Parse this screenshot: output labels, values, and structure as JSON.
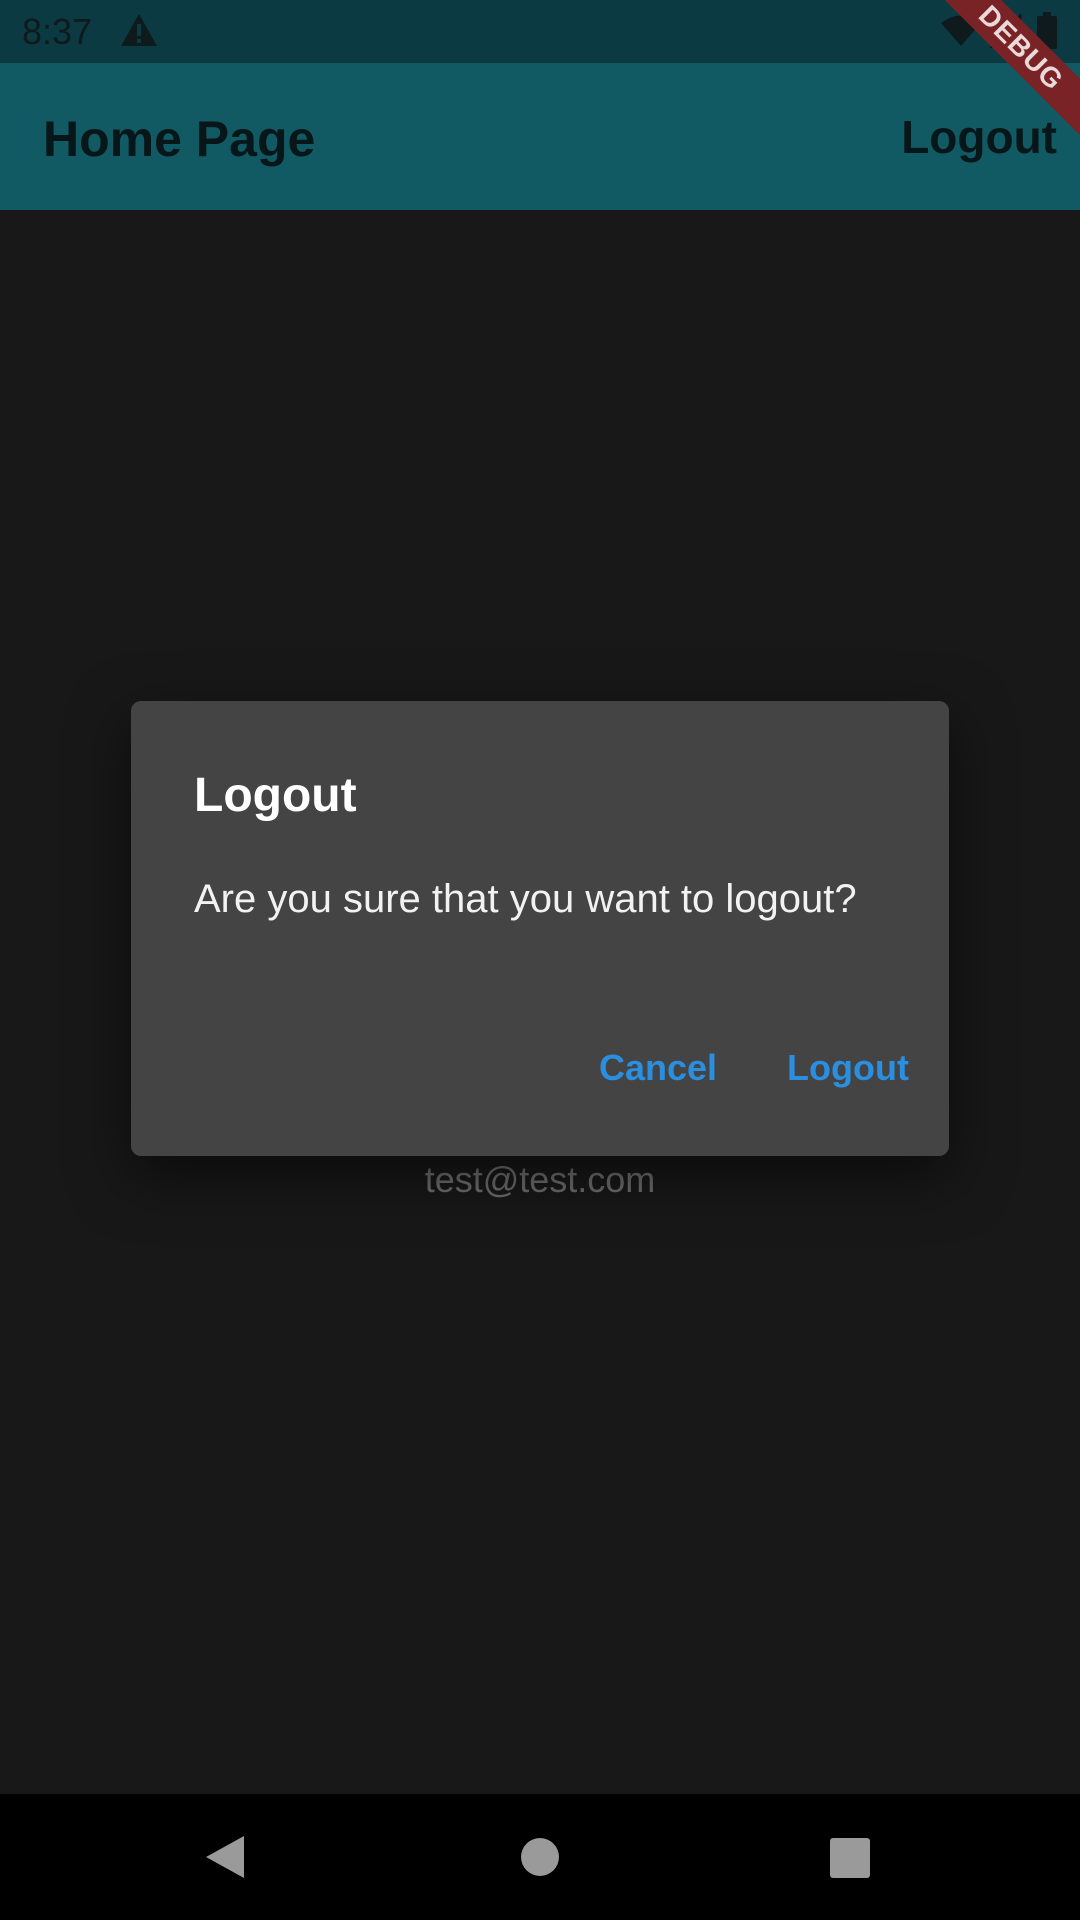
{
  "status_bar": {
    "time": "8:37",
    "icons": [
      "warning-icon",
      "wifi-icon",
      "signal-icon",
      "battery-icon"
    ]
  },
  "app_bar": {
    "title": "Home Page",
    "logout_label": "Logout",
    "background_color": "#115a63"
  },
  "debug_banner": {
    "label": "DEBUG",
    "color": "#7a2326"
  },
  "background_content": {
    "email": "test@test.com"
  },
  "dialog": {
    "title": "Logout",
    "message": "Are you sure that you want to logout?",
    "cancel_label": "Cancel",
    "confirm_label": "Logout",
    "button_color": "#2a8fe0",
    "background_color": "#444444"
  },
  "nav_bar": {
    "icons": [
      "back-icon",
      "home-icon",
      "recents-icon"
    ]
  }
}
